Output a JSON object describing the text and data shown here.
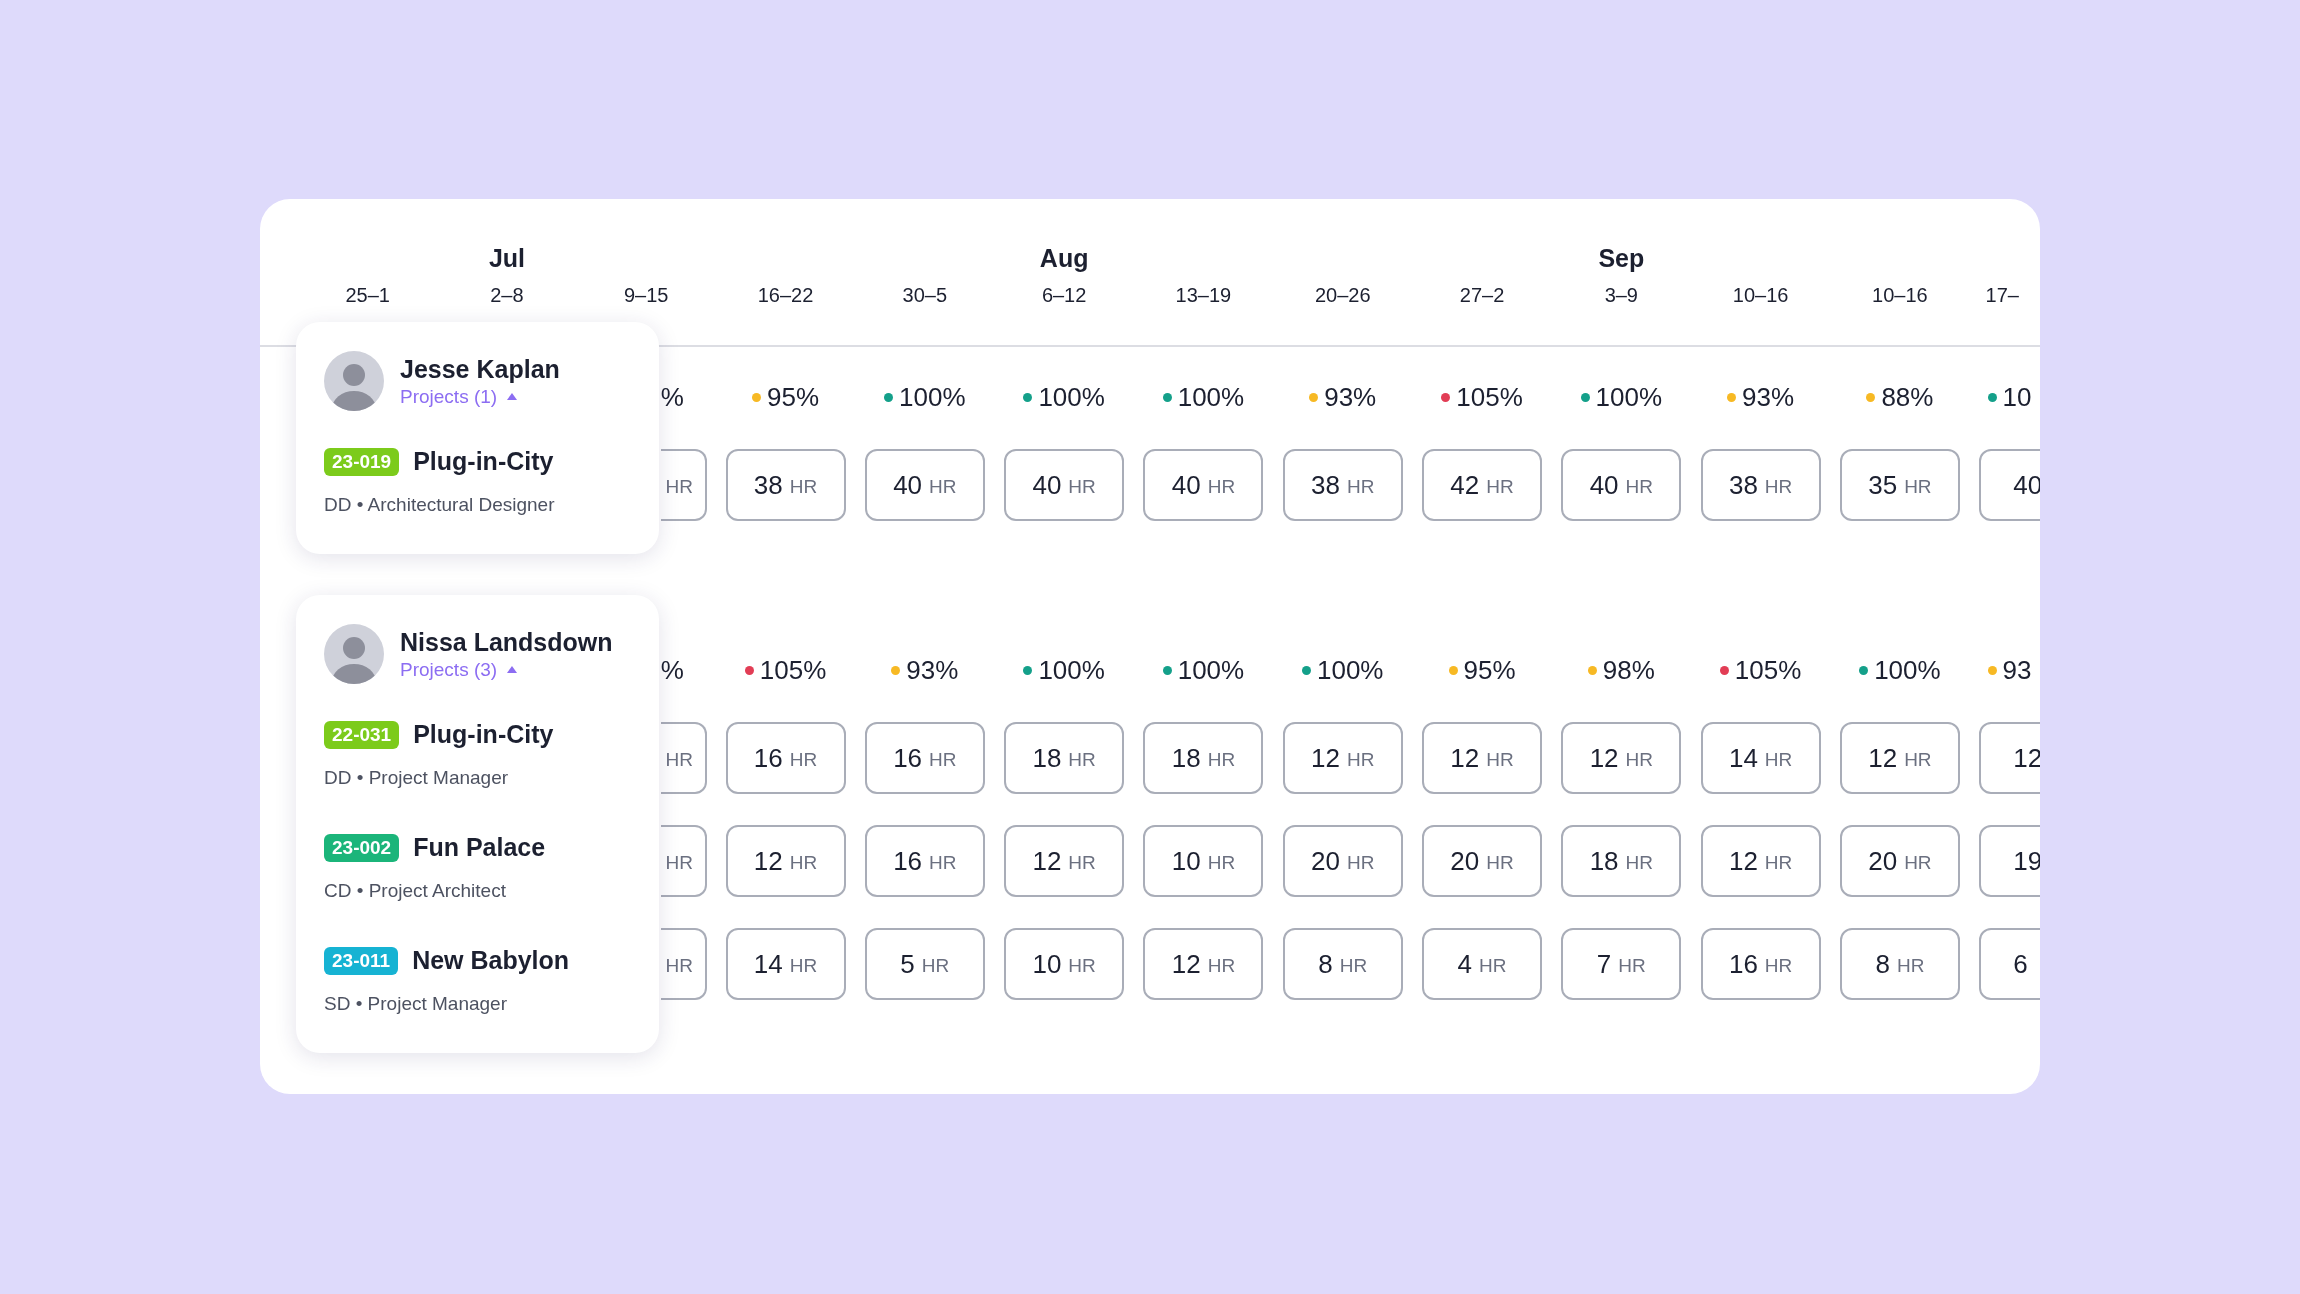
{
  "weeks": [
    {
      "label": "25–1"
    },
    {
      "label": "2–8",
      "month": "Jul"
    },
    {
      "label": "9–15"
    },
    {
      "label": "16–22"
    },
    {
      "label": "30–5"
    },
    {
      "label": "6–12",
      "month": "Aug"
    },
    {
      "label": "13–19"
    },
    {
      "label": "20–26"
    },
    {
      "label": "27–2"
    },
    {
      "label": "3–9",
      "month": "Sep"
    },
    {
      "label": "10–16"
    },
    {
      "label": "10–16"
    },
    {
      "label": "17–"
    }
  ],
  "people": [
    {
      "name": "Jesse Kaplan",
      "projects_link": "Projects (1)",
      "expanded": true,
      "projects": [
        {
          "code": "23-019",
          "color": "#7ccb1b",
          "name": "Plug-in-City",
          "role": "DD • Architectural Designer"
        }
      ],
      "utilization": [
        {
          "percent": "%"
        },
        {
          "percent": "95%",
          "color": "#f7b924"
        },
        {
          "percent": "100%",
          "color": "#14a08a"
        },
        {
          "percent": "100%",
          "color": "#14a08a"
        },
        {
          "percent": "100%",
          "color": "#14a08a"
        },
        {
          "percent": "93%",
          "color": "#f7b924"
        },
        {
          "percent": "105%",
          "color": "#e23d55"
        },
        {
          "percent": "100%",
          "color": "#14a08a"
        },
        {
          "percent": "93%",
          "color": "#f7b924"
        },
        {
          "percent": "88%",
          "color": "#f7b924"
        },
        {
          "percent": "10",
          "color": "#14a08a"
        }
      ],
      "hour_rows": [
        [
          {
            "unit": "HR"
          },
          {
            "hours": "38",
            "unit": "HR"
          },
          {
            "hours": "40",
            "unit": "HR"
          },
          {
            "hours": "40",
            "unit": "HR"
          },
          {
            "hours": "40",
            "unit": "HR"
          },
          {
            "hours": "38",
            "unit": "HR"
          },
          {
            "hours": "42",
            "unit": "HR"
          },
          {
            "hours": "40",
            "unit": "HR"
          },
          {
            "hours": "38",
            "unit": "HR"
          },
          {
            "hours": "35",
            "unit": "HR"
          },
          {
            "hours": "40"
          }
        ]
      ]
    },
    {
      "name": "Nissa Landsdown",
      "projects_link": "Projects (3)",
      "expanded": true,
      "projects": [
        {
          "code": "22-031",
          "color": "#7ccb1b",
          "name": "Plug-in-City",
          "role": "DD • Project Manager"
        },
        {
          "code": "23-002",
          "color": "#1bb57a",
          "name": "Fun Palace",
          "role": "CD • Project Architect"
        },
        {
          "code": "23-011",
          "color": "#16b3d3",
          "name": "New Babylon",
          "role": "SD • Project Manager"
        }
      ],
      "utilization": [
        {
          "percent": "%"
        },
        {
          "percent": "105%",
          "color": "#e23d55"
        },
        {
          "percent": "93%",
          "color": "#f7b924"
        },
        {
          "percent": "100%",
          "color": "#14a08a"
        },
        {
          "percent": "100%",
          "color": "#14a08a"
        },
        {
          "percent": "100%",
          "color": "#14a08a"
        },
        {
          "percent": "95%",
          "color": "#f7b924"
        },
        {
          "percent": "98%",
          "color": "#f7b924"
        },
        {
          "percent": "105%",
          "color": "#e23d55"
        },
        {
          "percent": "100%",
          "color": "#14a08a"
        },
        {
          "percent": "93",
          "color": "#f7b924"
        }
      ],
      "hour_rows": [
        [
          {
            "unit": "HR"
          },
          {
            "hours": "16",
            "unit": "HR"
          },
          {
            "hours": "16",
            "unit": "HR"
          },
          {
            "hours": "18",
            "unit": "HR"
          },
          {
            "hours": "18",
            "unit": "HR"
          },
          {
            "hours": "12",
            "unit": "HR"
          },
          {
            "hours": "12",
            "unit": "HR"
          },
          {
            "hours": "12",
            "unit": "HR"
          },
          {
            "hours": "14",
            "unit": "HR"
          },
          {
            "hours": "12",
            "unit": "HR"
          },
          {
            "hours": "12"
          }
        ],
        [
          {
            "unit": "HR"
          },
          {
            "hours": "12",
            "unit": "HR"
          },
          {
            "hours": "16",
            "unit": "HR"
          },
          {
            "hours": "12",
            "unit": "HR"
          },
          {
            "hours": "10",
            "unit": "HR"
          },
          {
            "hours": "20",
            "unit": "HR"
          },
          {
            "hours": "20",
            "unit": "HR"
          },
          {
            "hours": "18",
            "unit": "HR"
          },
          {
            "hours": "12",
            "unit": "HR"
          },
          {
            "hours": "20",
            "unit": "HR"
          },
          {
            "hours": "19"
          }
        ],
        [
          {
            "unit": "HR"
          },
          {
            "hours": "14",
            "unit": "HR"
          },
          {
            "hours": "5",
            "unit": "HR"
          },
          {
            "hours": "10",
            "unit": "HR"
          },
          {
            "hours": "12",
            "unit": "HR"
          },
          {
            "hours": "8",
            "unit": "HR"
          },
          {
            "hours": "4",
            "unit": "HR"
          },
          {
            "hours": "7",
            "unit": "HR"
          },
          {
            "hours": "16",
            "unit": "HR"
          },
          {
            "hours": "8",
            "unit": "HR"
          },
          {
            "hours": "6"
          }
        ]
      ]
    }
  ]
}
